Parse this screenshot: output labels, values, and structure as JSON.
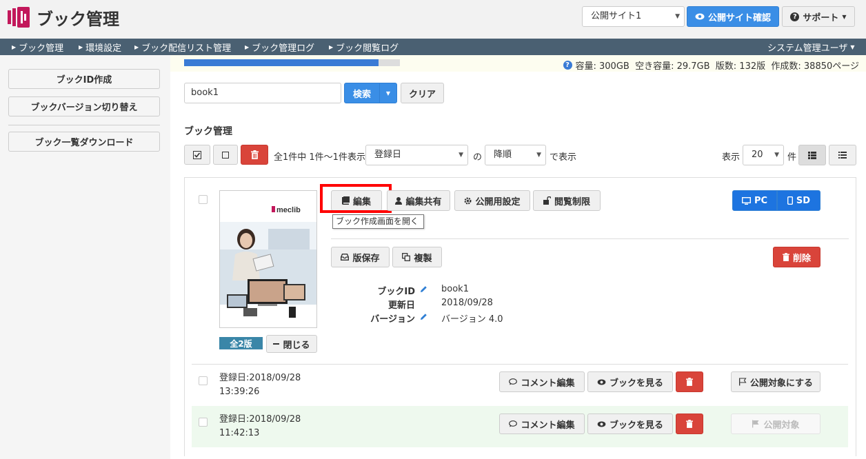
{
  "header": {
    "title": "ブック管理",
    "site_select": "公開サイト1",
    "confirm_site": "公開サイト確認",
    "support": "サポート"
  },
  "nav": {
    "items": [
      "ブック管理",
      "環境設定",
      "ブック配信リスト管理",
      "ブック管理ログ",
      "ブック閲覧ログ"
    ],
    "user": "システム管理ユーザ"
  },
  "sidebar": {
    "items": [
      "ブックID作成",
      "ブックバージョン切り替え",
      "ブック一覧ダウンロード"
    ]
  },
  "storage": {
    "usage_fraction": 0.9,
    "text": "容量: 300GB  空き容量: 29.7GB  版数: 132版  作成数: 38850ページ"
  },
  "search": {
    "value": "book1",
    "search_label": "検索",
    "clear_label": "クリア"
  },
  "list": {
    "title": "ブック管理",
    "count_text": "全1件中 1件～1件表示",
    "sort_field": "登録日",
    "sort_of": "の",
    "sort_order": "降順",
    "sort_suffix": "で表示",
    "display_label": "表示",
    "per_page": "20",
    "per_page_unit": "件"
  },
  "book": {
    "edit": "編集",
    "edit_tooltip": "ブック作成画面を開く",
    "share": "編集共有",
    "publish_settings": "公開用設定",
    "view_limit": "閲覧制限",
    "pc": "PC",
    "sd": "SD",
    "save_version": "版保存",
    "duplicate": "複製",
    "delete": "削除",
    "id_label": "ブックID",
    "id_value": "book1",
    "updated_label": "更新日",
    "updated_value": "2018/09/28",
    "version_label": "バージョン",
    "version_value": "バージョン 4.0",
    "versions_badge": "全2版",
    "close": "閉じる",
    "cover_logo": "meclib"
  },
  "versions": [
    {
      "date": "登録日:2018/09/28",
      "time": "13:39:26",
      "comment": "コメント編集",
      "view": "ブックを見る",
      "publish": "公開対象にする"
    },
    {
      "date": "登録日:2018/09/28",
      "time": "11:42:13",
      "comment": "コメント編集",
      "view": "ブックを見る",
      "publish": "公開対象"
    }
  ]
}
